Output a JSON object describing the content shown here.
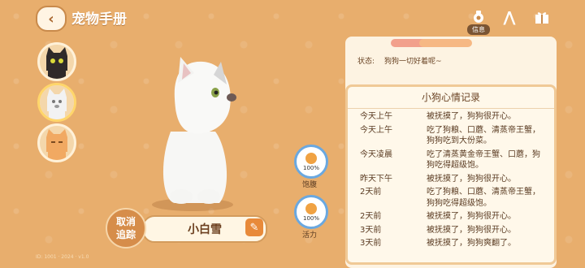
{
  "header": {
    "title": "宠物手册",
    "info_label": "信息"
  },
  "pets": [
    {
      "name": "black-cat"
    },
    {
      "name": "white-dog",
      "selected": true
    },
    {
      "name": "orange-cat"
    }
  ],
  "pet": {
    "name": "小白雪",
    "stats": [
      {
        "label": "饱腹",
        "value": "100%",
        "color": "#f0a243"
      },
      {
        "label": "活力",
        "value": "100%",
        "color": "#f0a243"
      }
    ]
  },
  "cancel_track": {
    "line1": "取消",
    "line2": "追踪"
  },
  "footer_note": "ID: 1001 · 2024 · v1.0",
  "status": {
    "label": "状态:",
    "value": "狗狗一切好着呢~"
  },
  "mood": {
    "title": "小狗心情记录",
    "entries": [
      {
        "time": "今天上午",
        "text": "被抚摸了，狗狗很开心。"
      },
      {
        "time": "今天上午",
        "text": "吃了狗粮、口蘑、清蒸帝王蟹，狗狗吃到大份菜。"
      },
      {
        "time": "今天凌晨",
        "text": "吃了清蒸黄金帝王蟹、口蘑，狗狗吃得超级饱。"
      },
      {
        "time": "昨天下午",
        "text": "被抚摸了，狗狗很开心。"
      },
      {
        "time": "2天前",
        "text": "吃了狗粮、口蘑、清蒸帝王蟹，狗狗吃得超级饱。"
      },
      {
        "time": "2天前",
        "text": "被抚摸了，狗狗很开心。"
      },
      {
        "time": "3天前",
        "text": "被抚摸了，狗狗很开心。"
      },
      {
        "time": "3天前",
        "text": "被抚摸了，狗狗爽翻了。"
      }
    ]
  }
}
